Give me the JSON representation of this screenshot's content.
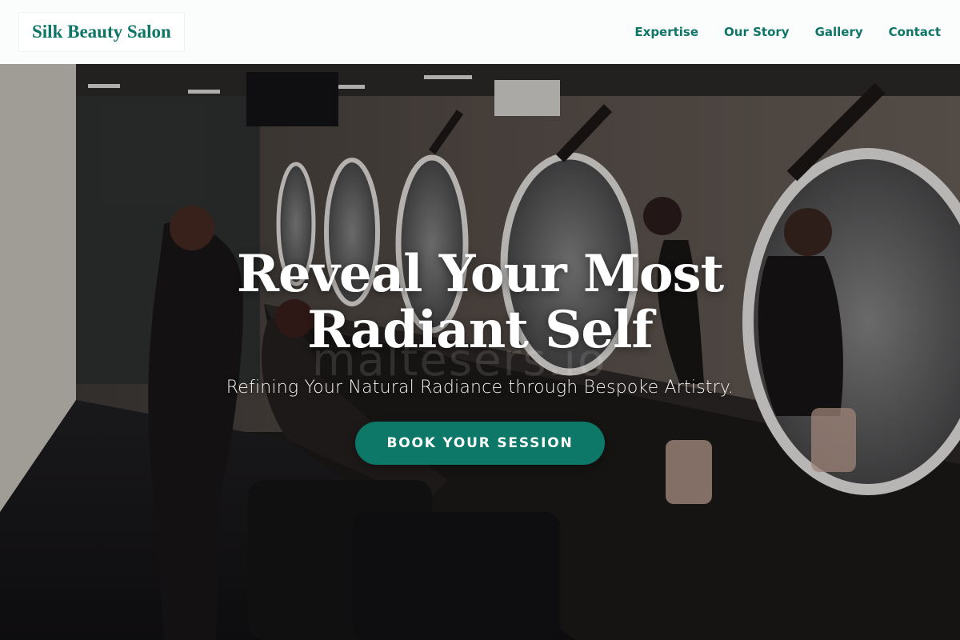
{
  "header": {
    "logo": "Silk Beauty Salon",
    "nav": [
      {
        "label": "Expertise"
      },
      {
        "label": "Our Story"
      },
      {
        "label": "Gallery"
      },
      {
        "label": "Contact"
      }
    ]
  },
  "hero": {
    "title": "Reveal Your Most Radiant Self",
    "subtitle": "Refining Your Natural Radiance through Bespoke Artistry.",
    "cta_label": "BOOK YOUR SESSION",
    "watermark": "maltesers.io"
  },
  "colors": {
    "brand": "#0f7566",
    "cta": "#0d7768",
    "header_bg": "#fbfcfc"
  }
}
